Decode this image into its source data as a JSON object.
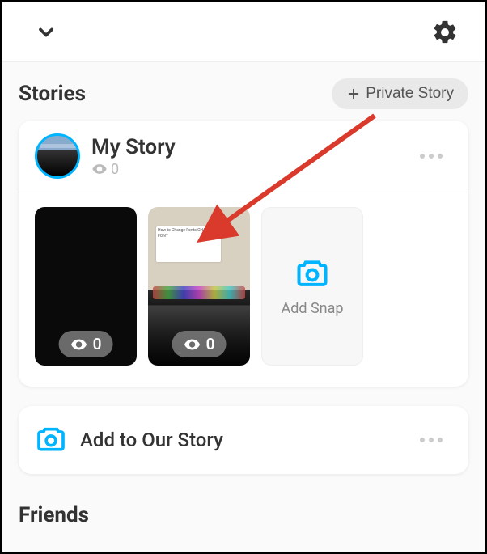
{
  "sections": {
    "stories_title": "Stories",
    "friends_title": "Friends"
  },
  "header": {
    "private_story_label": "Private Story"
  },
  "my_story": {
    "title": "My Story",
    "view_count": "0",
    "snaps": [
      {
        "views": "0"
      },
      {
        "views": "0"
      }
    ],
    "add_snap_label": "Add Snap"
  },
  "our_story": {
    "label": "Add to Our Story"
  },
  "colors": {
    "accent": "#00B4FF"
  }
}
